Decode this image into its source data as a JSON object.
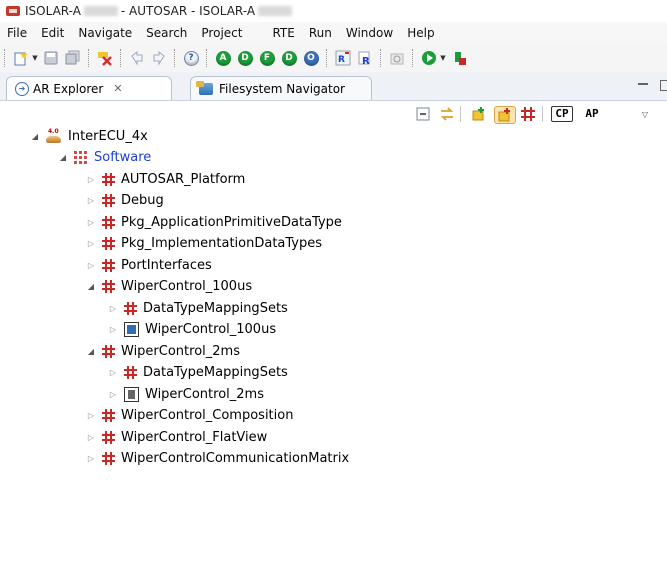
{
  "window": {
    "title_prefix": "ISOLAR-A",
    "title_middle": "- AUTOSAR - ISOLAR-A"
  },
  "menu": [
    "File",
    "Edit",
    "Navigate",
    "Search",
    "Project",
    "RTE",
    "Run",
    "Window",
    "Help"
  ],
  "toolbar": {
    "help_glyph": "?",
    "circle_buttons": [
      "A",
      "D",
      "F",
      "D",
      "O"
    ]
  },
  "tabs": {
    "active_label": "AR Explorer",
    "active_close": "✕",
    "inactive_label": "Filesystem Navigator"
  },
  "view_toolbar": {
    "cp_label": "CP",
    "ap_label": "AP"
  },
  "tree": {
    "root": "InterECU_4x",
    "software": "Software",
    "items": [
      "AUTOSAR_Platform",
      "Debug",
      "Pkg_ApplicationPrimitiveDataType",
      "Pkg_ImplementationDataTypes",
      "PortInterfaces",
      "WiperControl_100us",
      "DataTypeMappingSets",
      "WiperControl_100us",
      "WiperControl_2ms",
      "DataTypeMappingSets",
      "WiperControl_2ms",
      "WiperControl_Composition",
      "WiperControl_FlatView",
      "WiperControlCommunicationMatrix"
    ]
  },
  "colors": {
    "package_red": "#c62828",
    "link_blue": "#1d3fcf",
    "toolbar_green": "#1c9c3a"
  }
}
